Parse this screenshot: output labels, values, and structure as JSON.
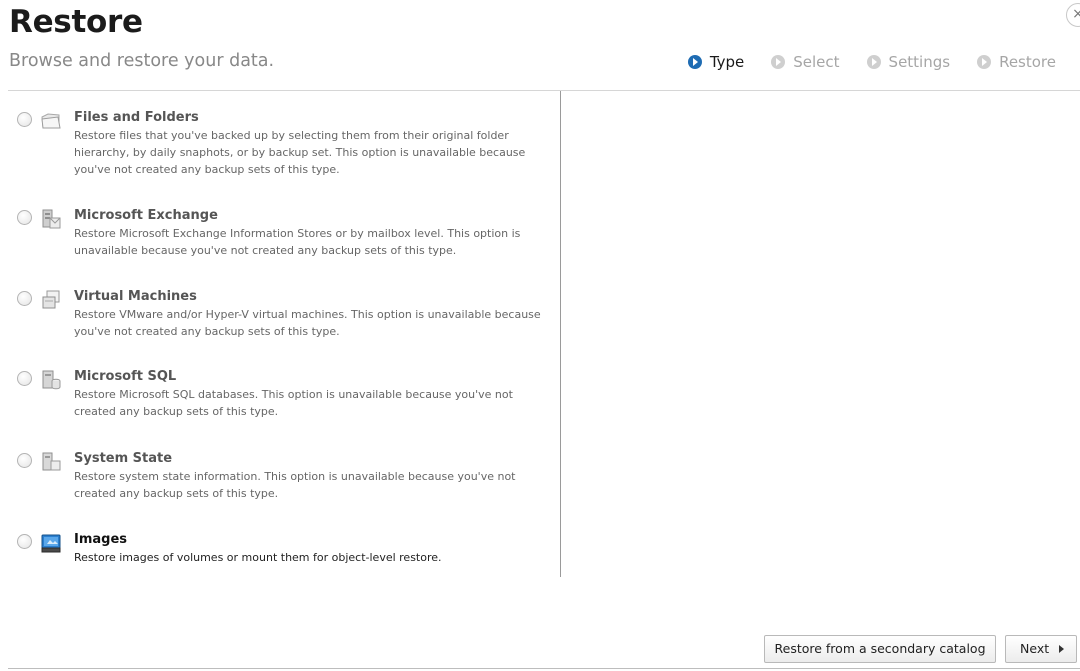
{
  "header": {
    "title": "Restore",
    "subtitle": "Browse and restore your data.",
    "close_glyph": "×"
  },
  "steps": [
    {
      "label": "Type",
      "active": true
    },
    {
      "label": "Select",
      "active": false
    },
    {
      "label": "Settings",
      "active": false
    },
    {
      "label": "Restore",
      "active": false
    }
  ],
  "options": [
    {
      "title": "Files and Folders",
      "description": "Restore files that you've backed up by selecting them from their original folder hierarchy, by daily snaphots, or by backup set. This option is unavailable because you've not created any backup sets of this type.",
      "icon": "folder-icon",
      "enabled": false
    },
    {
      "title": "Microsoft Exchange",
      "description": "Restore Microsoft Exchange Information Stores or by mailbox level. This option is unavailable because you've not created any backup sets of this type.",
      "icon": "exchange-server-icon",
      "enabled": false
    },
    {
      "title": "Virtual Machines",
      "description": "Restore VMware and/or Hyper-V virtual machines. This option is unavailable because you've not created any backup sets of this type.",
      "icon": "virtual-machine-icon",
      "enabled": false
    },
    {
      "title": "Microsoft SQL",
      "description": "Restore Microsoft SQL databases. This option is unavailable because you've not created any backup sets of this type.",
      "icon": "sql-server-icon",
      "enabled": false
    },
    {
      "title": "System State",
      "description": "Restore system state information. This option is unavailable because you've not created any backup sets of this type.",
      "icon": "system-state-icon",
      "enabled": false
    },
    {
      "title": "Images",
      "description": "Restore images of volumes or mount them for object-level restore.",
      "icon": "disk-image-icon",
      "enabled": true
    }
  ],
  "buttons": {
    "secondary_catalog": "Restore from a secondary catalog",
    "next": "Next"
  },
  "colors": {
    "accent": "#1f6cb3",
    "inactive_step": "#cfcfcf",
    "divider": "#d6d6d6"
  }
}
